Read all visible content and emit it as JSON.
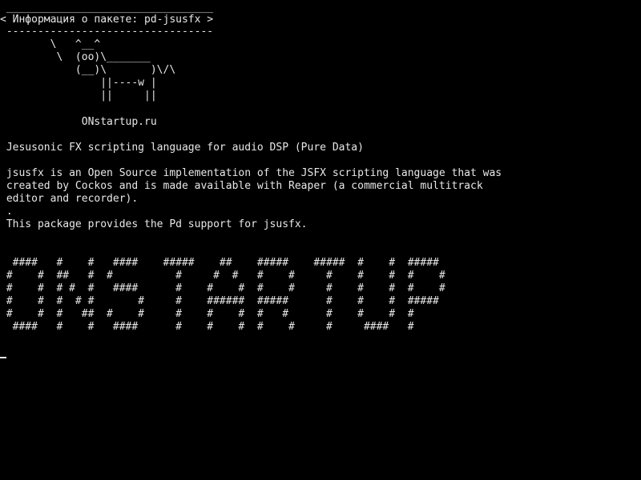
{
  "terminal": {
    "header": {
      "border_top": " _________________________________",
      "title": "< Информация о пакете: pd-jsusfx >",
      "border_bottom": " ---------------------------------"
    },
    "ascii_cow": [
      "        \\   ^__^",
      "         \\  (oo)\\_______",
      "            (__)\\       )\\/\\",
      "                ||----w |",
      "                ||     ||"
    ],
    "site": "             ONstartup.ru",
    "package_summary": " Jesusonic FX scripting language for audio DSP (Pure Data)",
    "description": [
      " jsusfx is an Open Source implementation of the JSFX scripting language that was",
      " created by Cockos and is made available with Reaper (a commercial multitrack",
      " editor and recorder).",
      " .",
      " This package provides the Pd support for jsusfx."
    ],
    "banner": [
      "  ####   #    #   ####    #####    ##    #####    #####  #    #  #####",
      " #    #  ##   #  #          #     #  #   #    #     #    #    #  #    #",
      " #    #  # #  #   ####      #    #    #  #    #     #    #    #  #    #",
      " #    #  #  # #       #     #    ######  #####      #    #    #  #####",
      " #    #  #   ##  #    #     #    #    #  #   #      #    #    #  #",
      "  ####   #    #   ####      #    #    #  #    #     #     ####   #"
    ]
  }
}
